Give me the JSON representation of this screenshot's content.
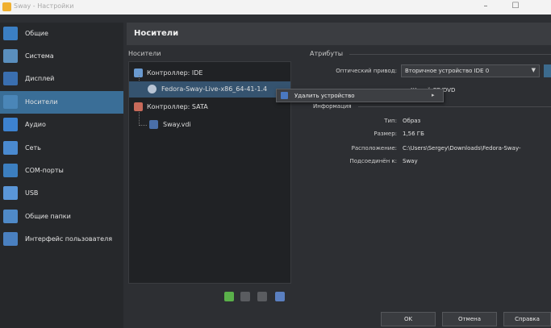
{
  "window": {
    "title": "Sway - Настройки",
    "minimize": "–",
    "maximize": "☐"
  },
  "sidebar": {
    "items": [
      {
        "label": "Общие",
        "icon": "general-icon",
        "color": "#3b7fc4"
      },
      {
        "label": "Система",
        "icon": "system-icon",
        "color": "#5a8fbe"
      },
      {
        "label": "Дисплей",
        "icon": "display-icon",
        "color": "#3a6fb0"
      },
      {
        "label": "Носители",
        "icon": "storage-icon",
        "color": "#4a86b8",
        "active": true
      },
      {
        "label": "Аудио",
        "icon": "audio-icon",
        "color": "#3d82d0"
      },
      {
        "label": "Сеть",
        "icon": "network-icon",
        "color": "#4a8ad0"
      },
      {
        "label": "COM-порты",
        "icon": "serial-ports-icon",
        "color": "#3c7fc0"
      },
      {
        "label": "USB",
        "icon": "usb-icon",
        "color": "#5a96d8"
      },
      {
        "label": "Общие папки",
        "icon": "shared-folders-icon",
        "color": "#4f8ac8"
      },
      {
        "label": "Интерфейс пользователя",
        "icon": "user-interface-icon",
        "color": "#4a80c0"
      }
    ]
  },
  "header": {
    "title": "Носители"
  },
  "storage": {
    "section_label": "Носители",
    "controller_ide": "Контроллер: IDE",
    "ide_device": "Fedora-Sway-Live-x86_64-41-1.4",
    "controller_sata": "Контроллер: SATA",
    "sata_device": "Sway.vdi"
  },
  "attributes": {
    "section_label": "Атрибуты",
    "optical_drive_label": "Оптический привод:",
    "optical_drive_value": "Вторичное устройство IDE 0",
    "caret": "▼",
    "live_cd": "Живой CD/DVD"
  },
  "popup": {
    "label": "Удалить устройство",
    "arrow": "▸"
  },
  "information": {
    "section_label": "Информация",
    "rows": [
      {
        "key": "Тип:",
        "value": "Образ"
      },
      {
        "key": "Размер:",
        "value": "1,56 ГБ"
      },
      {
        "key": "Расположение:",
        "value": "C:\\Users\\Sergey\\Downloads\\Fedora-Sway-"
      },
      {
        "key": "Подсоединён к:",
        "value": "Sway"
      }
    ]
  },
  "footer": {
    "ok": "OK",
    "cancel": "Отмена",
    "help": "Справка"
  },
  "colors": {
    "accent": "#3a6e97",
    "selection": "#35536f",
    "background": "#2d2f33"
  }
}
